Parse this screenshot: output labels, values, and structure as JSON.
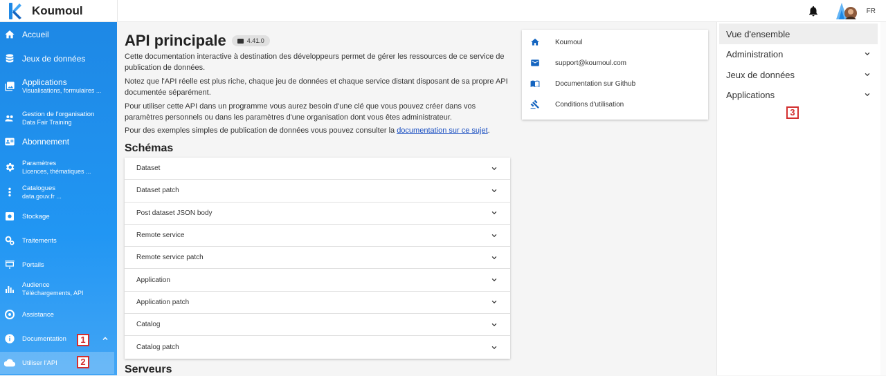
{
  "app": {
    "name": "Koumoul",
    "lang": "FR"
  },
  "sidebar": {
    "items": [
      {
        "label": "Accueil",
        "sub": ""
      },
      {
        "label": "Jeux de données",
        "sub": ""
      },
      {
        "label": "Applications",
        "sub": "Visualisations, formulaires ..."
      },
      {
        "label": "Gestion de l'organisation",
        "sub": "Data Fair Training"
      },
      {
        "label": "Abonnement",
        "sub": ""
      },
      {
        "label": "Paramètres",
        "sub": "Licences, thématiques ..."
      },
      {
        "label": "Catalogues",
        "sub": "data.gouv.fr ..."
      },
      {
        "label": "Stockage",
        "sub": ""
      },
      {
        "label": "Traitements",
        "sub": ""
      },
      {
        "label": "Portails",
        "sub": ""
      },
      {
        "label": "Audience",
        "sub": "Téléchargements, API"
      },
      {
        "label": "Assistance",
        "sub": ""
      },
      {
        "label": "Documentation",
        "sub": ""
      },
      {
        "label": "Utiliser l'API",
        "sub": ""
      }
    ],
    "badges": [
      "1",
      "2"
    ]
  },
  "main": {
    "title": "API principale",
    "version": "4.41.0",
    "paragraphs": [
      "Cette documentation interactive à destination des développeurs permet de gérer les ressources de ce service de publication de données.",
      "Notez que l'API réelle est plus riche, chaque jeu de données et chaque service distant disposant de sa propre API documentée séparément.",
      "Pour utiliser cette API dans un programme vous aurez besoin d'une clé que vous pouvez créer dans vos paramètres personnels ou dans les paramètres d'une organisation dont vous êtes administrateur."
    ],
    "examples_prefix": "Pour des exemples simples de publication de données vous pouvez consulter la ",
    "examples_link": "documentation sur ce sujet",
    "examples_suffix": ".",
    "schemas_title": "Schémas",
    "schemas": [
      "Dataset",
      "Dataset patch",
      "Post dataset JSON body",
      "Remote service",
      "Remote service patch",
      "Application",
      "Application patch",
      "Catalog",
      "Catalog patch"
    ],
    "servers_title": "Serveurs"
  },
  "info": {
    "items": [
      "Koumoul",
      "support@koumoul.com",
      "Documentation sur Github",
      "Conditions d'utilisation"
    ]
  },
  "toc": {
    "items": [
      "Vue d'ensemble",
      "Administration",
      "Jeux de données",
      "Applications"
    ],
    "badge": "3"
  },
  "colors": {
    "sidebar": "#2196f3",
    "accent": "#1565c0",
    "badge": "#d32f2f"
  }
}
